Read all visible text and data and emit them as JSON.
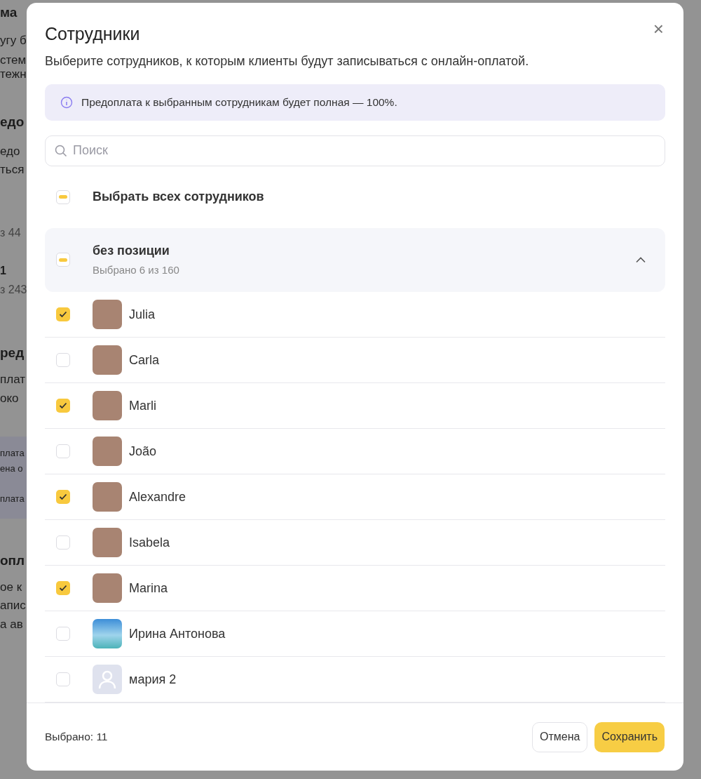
{
  "background_fragments": [
    {
      "text": "ма",
      "kind": "heading"
    },
    {
      "text": "угу б",
      "kind": "text"
    },
    {
      "text": "стем",
      "kind": "text"
    },
    {
      "text": "тежн",
      "kind": "text"
    },
    {
      "text": "едо",
      "kind": "heading"
    },
    {
      "text": "едо",
      "kind": "text"
    },
    {
      "text": "ться",
      "kind": "text"
    },
    {
      "text": "з 44",
      "kind": "muted"
    },
    {
      "text": "1",
      "kind": "strong"
    },
    {
      "text": "з 243",
      "kind": "muted"
    },
    {
      "text": "ред",
      "kind": "heading"
    },
    {
      "text": "плат",
      "kind": "text"
    },
    {
      "text": "око",
      "kind": "text"
    },
    {
      "text": "плата",
      "kind": "shaded"
    },
    {
      "text": "ена о",
      "kind": "shaded"
    },
    {
      "text": "плата",
      "kind": "shaded"
    },
    {
      "text": "опл",
      "kind": "heading"
    },
    {
      "text": "ое к",
      "kind": "text"
    },
    {
      "text": "апис",
      "kind": "text"
    },
    {
      "text": "а ав",
      "kind": "text"
    }
  ],
  "dialog": {
    "title": "Сотрудники",
    "close": "×",
    "subtitle": "Выберите сотрудников, к которым клиенты будут записываться с онлайн-оплатой.",
    "info": "Предоплата к выбранным сотрудникам будет полная — 100%.",
    "search": {
      "placeholder": "Поиск"
    },
    "select_all": {
      "label": "Выбрать всех сотрудников",
      "indeterminate": true
    },
    "group": {
      "title": "без позиции",
      "subtitle": "Выбрано 6 из 160",
      "indeterminate": true,
      "expanded": true
    },
    "employees": [
      {
        "name": "Julia",
        "checked": true,
        "kind": "photo"
      },
      {
        "name": "Carla",
        "checked": false,
        "kind": "photo"
      },
      {
        "name": "Marli",
        "checked": true,
        "kind": "photo"
      },
      {
        "name": "João",
        "checked": false,
        "kind": "photo"
      },
      {
        "name": "Alexandre",
        "checked": true,
        "kind": "photo"
      },
      {
        "name": "Isabela",
        "checked": false,
        "kind": "photo"
      },
      {
        "name": "Marina",
        "checked": true,
        "kind": "photo"
      },
      {
        "name": "Ирина Антонова",
        "checked": false,
        "kind": "landscape"
      },
      {
        "name": "мария 2",
        "checked": false,
        "kind": "silhouette"
      }
    ],
    "footer": {
      "count": "Выбрано: 11",
      "buttons": [
        {
          "label": "Отмена",
          "kind": "secondary"
        },
        {
          "label": "Сохранить",
          "kind": "primary"
        }
      ]
    }
  }
}
